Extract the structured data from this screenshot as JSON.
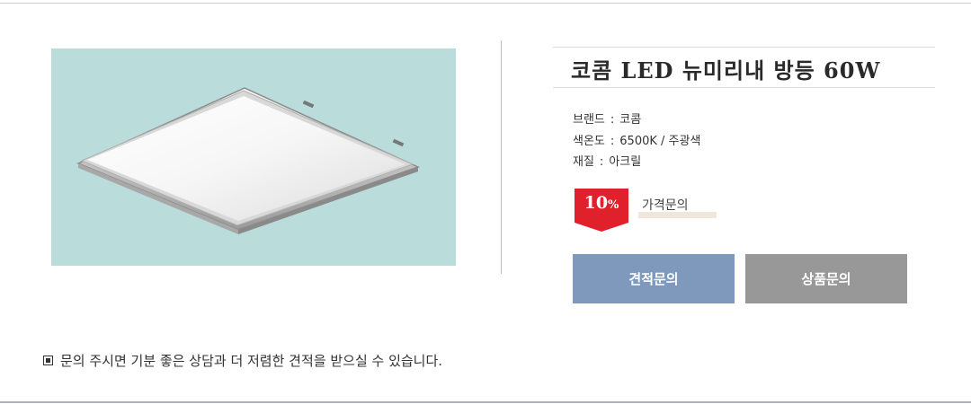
{
  "product": {
    "title": "코콤 LED 뉴미리내 방등 60W",
    "image_alt": "square LED ceiling light"
  },
  "specs": [
    {
      "label": "브랜드",
      "value": "코콤"
    },
    {
      "label": "색온도",
      "value": "6500K / 주광색"
    },
    {
      "label": "재질",
      "value": "아크릴"
    }
  ],
  "spec_separator": ":",
  "discount": {
    "value": "10",
    "unit": "%",
    "color": "#e0202b"
  },
  "price": {
    "label": "가격문의"
  },
  "buttons": {
    "quote_label": "견적문의",
    "product_inquiry_label": "상품문의",
    "quote_color": "#7e99bc",
    "product_inquiry_color": "#989898"
  },
  "notice": {
    "text": "문의 주시면 기분 좋은 상담과 더 저렴한 견적을 받으실 수 있습니다."
  }
}
